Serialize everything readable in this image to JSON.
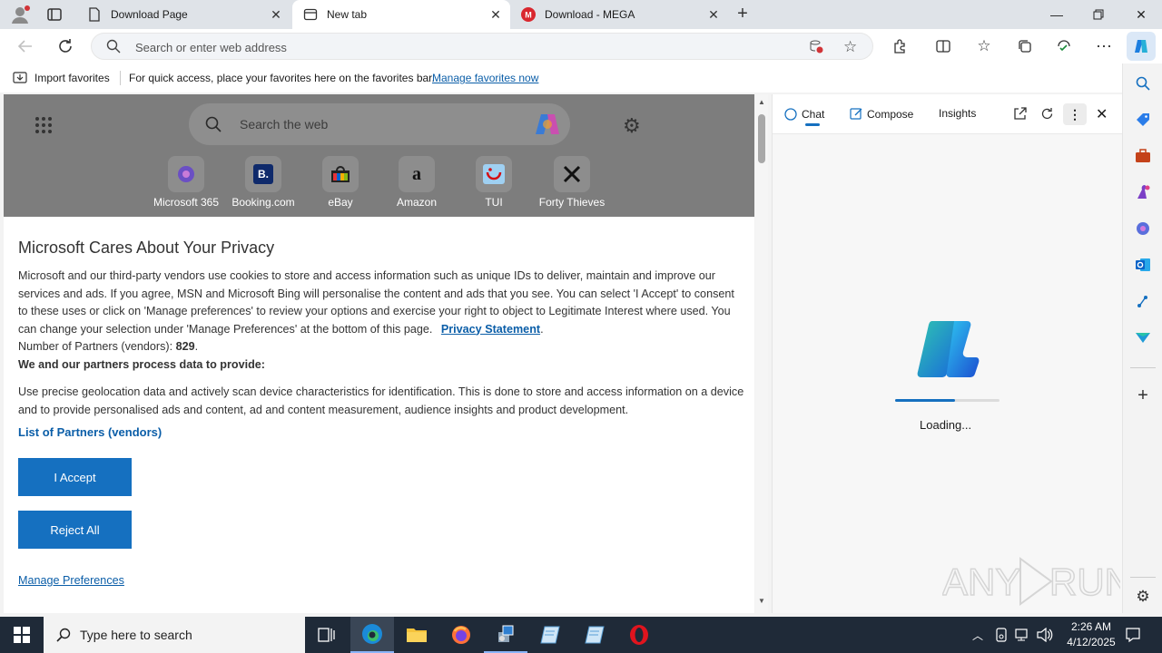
{
  "tabs": [
    {
      "title": "Download Page",
      "active": false,
      "icon": "page-icon"
    },
    {
      "title": "New tab",
      "active": true,
      "icon": "newtab-icon"
    },
    {
      "title": "Download - MEGA",
      "active": false,
      "icon": "mega-icon"
    }
  ],
  "address": {
    "placeholder": "Search or enter web address"
  },
  "favorites_bar": {
    "import_label": "Import favorites",
    "message": "For quick access, place your favorites here on the favorites bar.",
    "manage_link": "Manage favorites now"
  },
  "newtab": {
    "search_placeholder": "Search the web",
    "shortcuts": [
      "Microsoft 365",
      "Booking.com",
      "eBay",
      "Amazon",
      "TUI",
      "Forty Thieves"
    ]
  },
  "privacy": {
    "title": "Microsoft Cares About Your Privacy",
    "paragraph1": "Microsoft and our third-party vendors use cookies to store and access information such as unique IDs to deliver, maintain and improve our services and ads. If you agree, MSN and Microsoft Bing will personalise the content and ads that you see. You can select 'I Accept' to consent to these uses or click on 'Manage preferences' to review your options and exercise your right to object to Legitimate Interest where used.  You can change your selection under 'Manage Preferences' at the bottom of this page.",
    "privacy_statement_link": "Privacy Statement",
    "partners_count_label": "Number of Partners (vendors): ",
    "partners_count": "829",
    "process_heading": "We and our partners process data to provide:",
    "paragraph2": "Use precise geolocation data and actively scan device characteristics for identification. This is done to store and access information on a device and to provide personalised ads and content, ad and content measurement, audience insights and product development.",
    "partners_link": "List of Partners (vendors)",
    "accept_button": "I Accept",
    "reject_button": "Reject All",
    "manage_link": "Manage Preferences"
  },
  "copilot": {
    "tabs": [
      "Chat",
      "Compose",
      "Insights"
    ],
    "active_tab": "Chat",
    "loading_text": "Loading...",
    "loading_progress": 0.57
  },
  "taskbar": {
    "search_placeholder": "Type here to search",
    "time": "2:26 AM",
    "date": "4/12/2025"
  },
  "watermark": "ANY RUN",
  "colors": {
    "accent": "#1570c0",
    "link": "#0b5ea8",
    "taskbar": "#1f2a38"
  }
}
